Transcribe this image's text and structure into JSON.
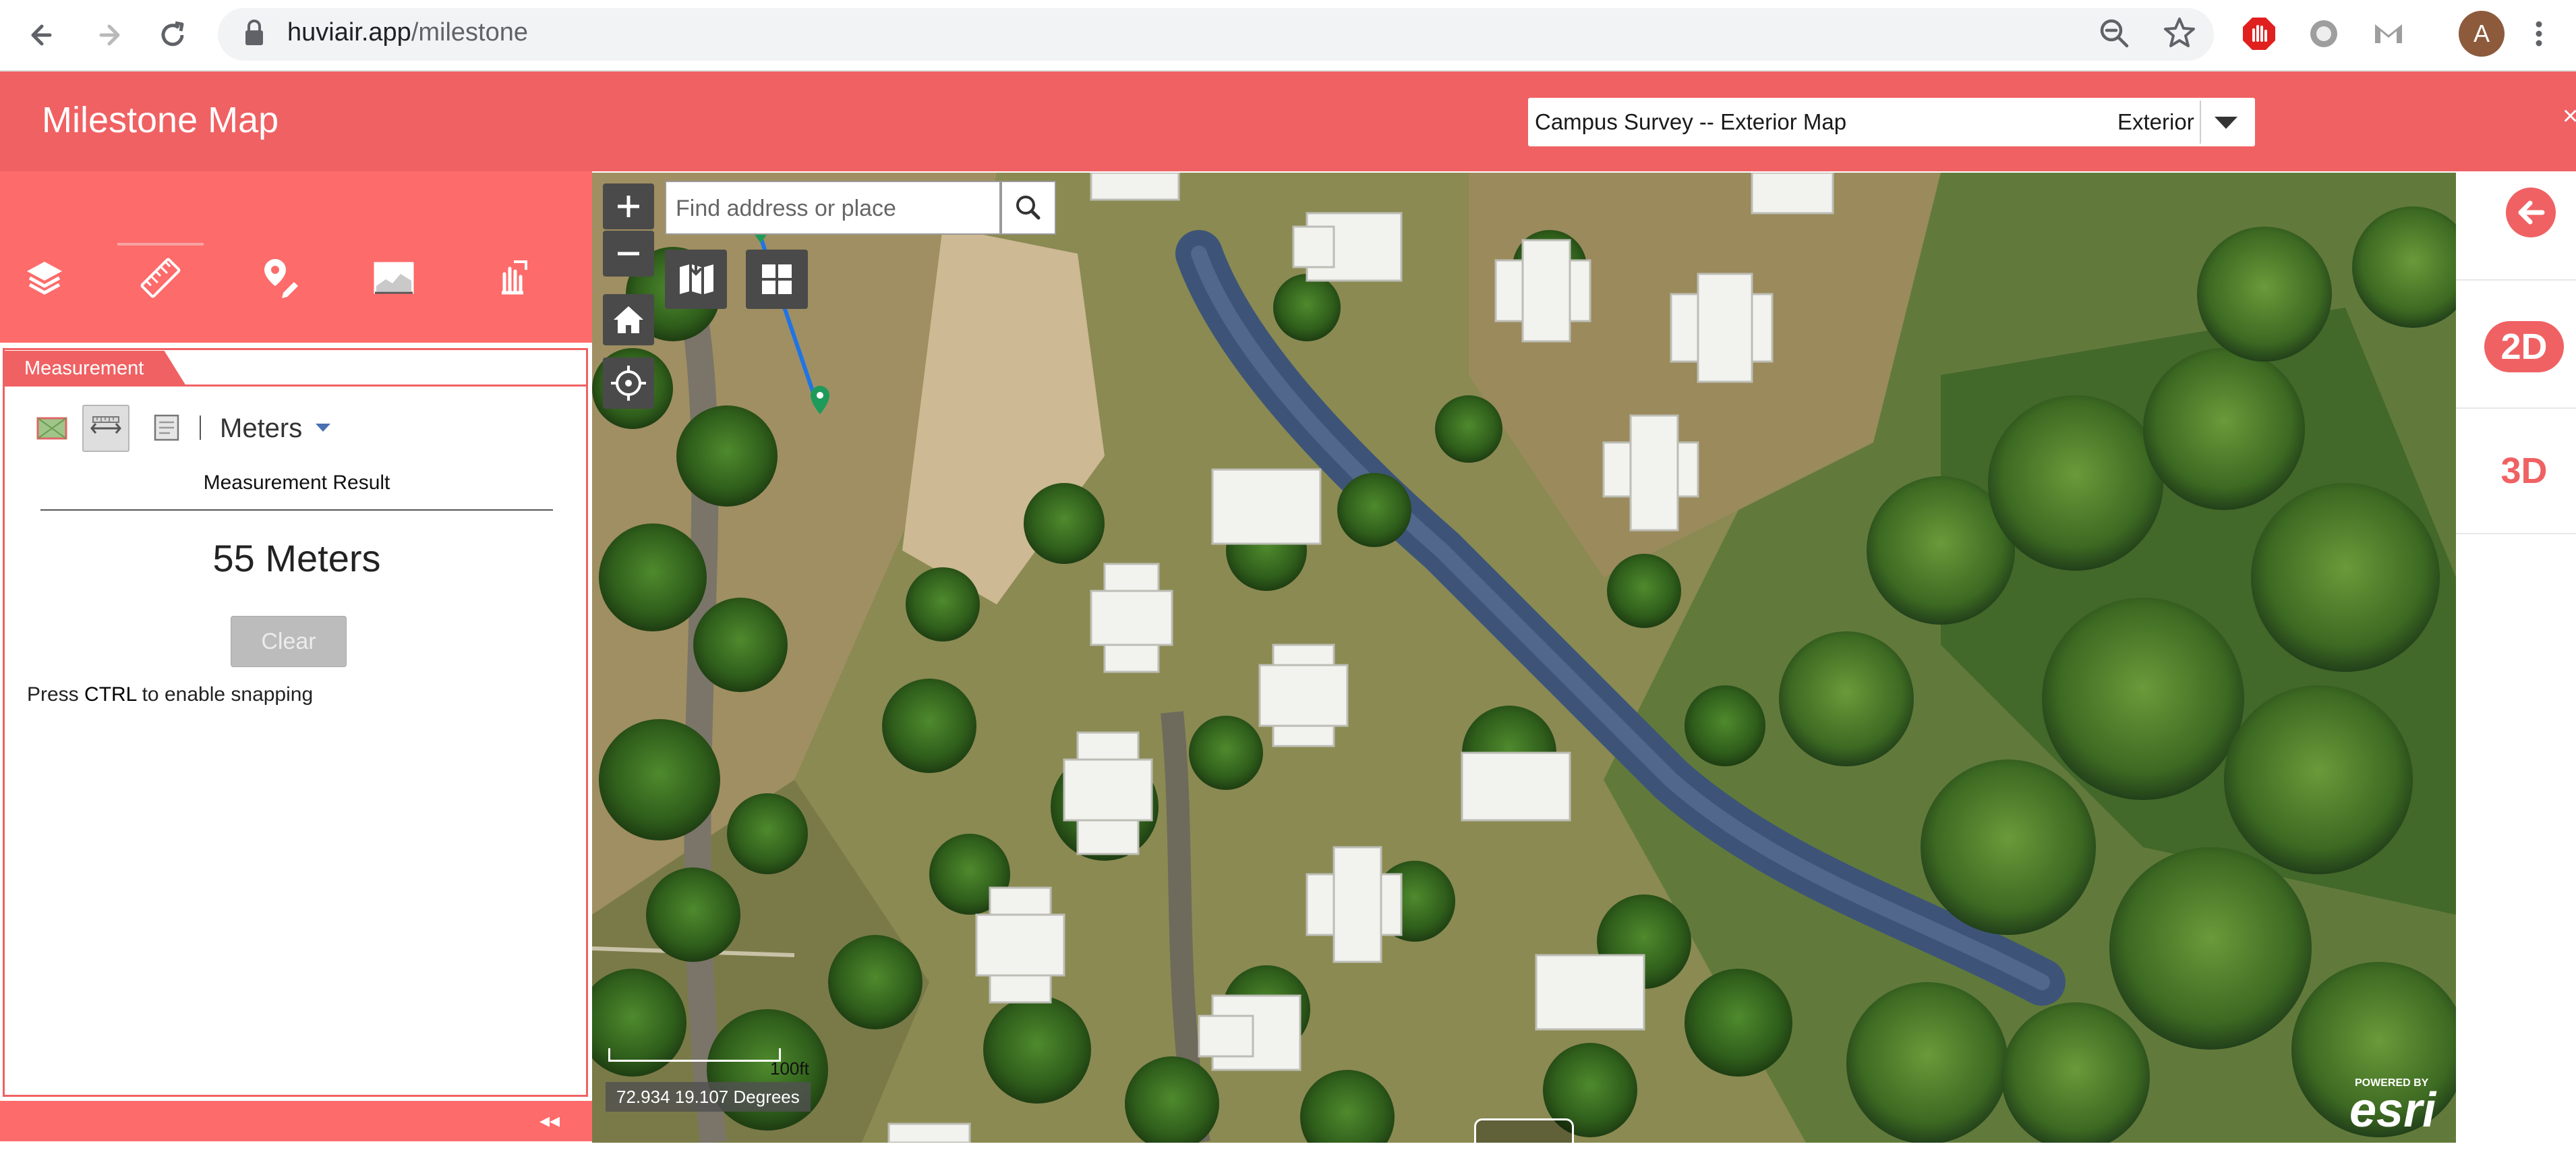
{
  "browser": {
    "url_host": "huviair.app",
    "url_path": "/milestone",
    "avatar_letter": "A"
  },
  "app": {
    "title": "Milestone Map",
    "map_selector": {
      "label": "Campus Survey -- Exterior Map",
      "value": "Exterior"
    },
    "close": "×"
  },
  "toolbar": {
    "tools": [
      "layers-icon",
      "ruler-icon",
      "pin-edit-icon",
      "elevation-profile-icon",
      "draw-icon"
    ],
    "active_tool": "ruler-icon"
  },
  "measurement": {
    "tab_label": "Measurement",
    "tools": [
      "area-icon",
      "distance-icon",
      "location-icon"
    ],
    "active_tool": "distance-icon",
    "unit": "Meters",
    "result_title": "Measurement Result",
    "result_value": "55 Meters",
    "clear_label": "Clear",
    "hint_prefix": "Press ",
    "hint_key": "CTRL",
    "hint_suffix": " to enable snapping",
    "collapse": "◂◂"
  },
  "map": {
    "search_placeholder": "Find address or place",
    "zoom_in": "+",
    "zoom_out": "−",
    "scale_label": "100ft",
    "coordinates": "72.934 19.107 Degrees",
    "attribution_small": "POWERED BY",
    "attribution_logo": "esri"
  },
  "view_modes": {
    "mode_2d": "2D",
    "mode_3d": "3D",
    "active": "2D"
  },
  "colors": {
    "header": "#f06163",
    "panel": "#fd6b6b",
    "measure_line": "#1f74e6",
    "marker": "#1e9a5a"
  }
}
